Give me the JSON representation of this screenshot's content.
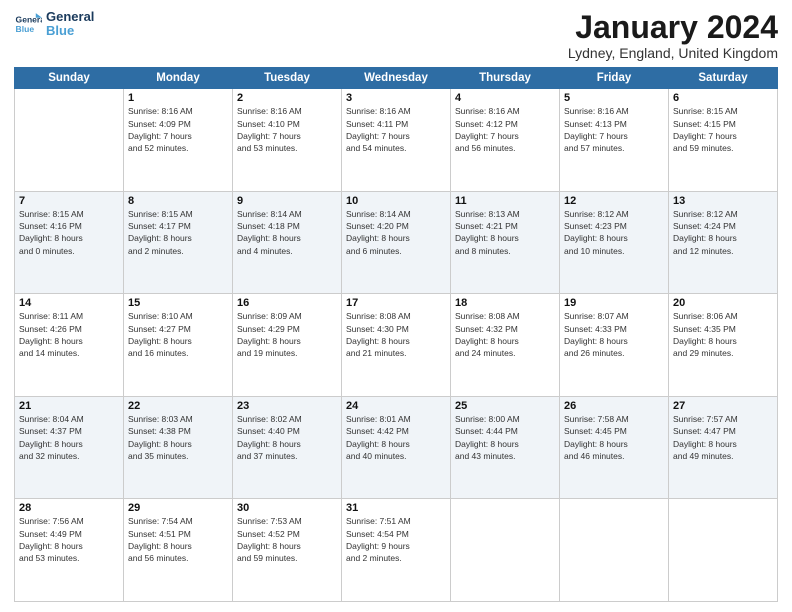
{
  "logo": {
    "line1": "General",
    "line2": "Blue"
  },
  "title": "January 2024",
  "location": "Lydney, England, United Kingdom",
  "days_header": [
    "Sunday",
    "Monday",
    "Tuesday",
    "Wednesday",
    "Thursday",
    "Friday",
    "Saturday"
  ],
  "weeks": [
    [
      {
        "num": "",
        "info": ""
      },
      {
        "num": "1",
        "info": "Sunrise: 8:16 AM\nSunset: 4:09 PM\nDaylight: 7 hours\nand 52 minutes."
      },
      {
        "num": "2",
        "info": "Sunrise: 8:16 AM\nSunset: 4:10 PM\nDaylight: 7 hours\nand 53 minutes."
      },
      {
        "num": "3",
        "info": "Sunrise: 8:16 AM\nSunset: 4:11 PM\nDaylight: 7 hours\nand 54 minutes."
      },
      {
        "num": "4",
        "info": "Sunrise: 8:16 AM\nSunset: 4:12 PM\nDaylight: 7 hours\nand 56 minutes."
      },
      {
        "num": "5",
        "info": "Sunrise: 8:16 AM\nSunset: 4:13 PM\nDaylight: 7 hours\nand 57 minutes."
      },
      {
        "num": "6",
        "info": "Sunrise: 8:15 AM\nSunset: 4:15 PM\nDaylight: 7 hours\nand 59 minutes."
      }
    ],
    [
      {
        "num": "7",
        "info": "Sunrise: 8:15 AM\nSunset: 4:16 PM\nDaylight: 8 hours\nand 0 minutes."
      },
      {
        "num": "8",
        "info": "Sunrise: 8:15 AM\nSunset: 4:17 PM\nDaylight: 8 hours\nand 2 minutes."
      },
      {
        "num": "9",
        "info": "Sunrise: 8:14 AM\nSunset: 4:18 PM\nDaylight: 8 hours\nand 4 minutes."
      },
      {
        "num": "10",
        "info": "Sunrise: 8:14 AM\nSunset: 4:20 PM\nDaylight: 8 hours\nand 6 minutes."
      },
      {
        "num": "11",
        "info": "Sunrise: 8:13 AM\nSunset: 4:21 PM\nDaylight: 8 hours\nand 8 minutes."
      },
      {
        "num": "12",
        "info": "Sunrise: 8:12 AM\nSunset: 4:23 PM\nDaylight: 8 hours\nand 10 minutes."
      },
      {
        "num": "13",
        "info": "Sunrise: 8:12 AM\nSunset: 4:24 PM\nDaylight: 8 hours\nand 12 minutes."
      }
    ],
    [
      {
        "num": "14",
        "info": "Sunrise: 8:11 AM\nSunset: 4:26 PM\nDaylight: 8 hours\nand 14 minutes."
      },
      {
        "num": "15",
        "info": "Sunrise: 8:10 AM\nSunset: 4:27 PM\nDaylight: 8 hours\nand 16 minutes."
      },
      {
        "num": "16",
        "info": "Sunrise: 8:09 AM\nSunset: 4:29 PM\nDaylight: 8 hours\nand 19 minutes."
      },
      {
        "num": "17",
        "info": "Sunrise: 8:08 AM\nSunset: 4:30 PM\nDaylight: 8 hours\nand 21 minutes."
      },
      {
        "num": "18",
        "info": "Sunrise: 8:08 AM\nSunset: 4:32 PM\nDaylight: 8 hours\nand 24 minutes."
      },
      {
        "num": "19",
        "info": "Sunrise: 8:07 AM\nSunset: 4:33 PM\nDaylight: 8 hours\nand 26 minutes."
      },
      {
        "num": "20",
        "info": "Sunrise: 8:06 AM\nSunset: 4:35 PM\nDaylight: 8 hours\nand 29 minutes."
      }
    ],
    [
      {
        "num": "21",
        "info": "Sunrise: 8:04 AM\nSunset: 4:37 PM\nDaylight: 8 hours\nand 32 minutes."
      },
      {
        "num": "22",
        "info": "Sunrise: 8:03 AM\nSunset: 4:38 PM\nDaylight: 8 hours\nand 35 minutes."
      },
      {
        "num": "23",
        "info": "Sunrise: 8:02 AM\nSunset: 4:40 PM\nDaylight: 8 hours\nand 37 minutes."
      },
      {
        "num": "24",
        "info": "Sunrise: 8:01 AM\nSunset: 4:42 PM\nDaylight: 8 hours\nand 40 minutes."
      },
      {
        "num": "25",
        "info": "Sunrise: 8:00 AM\nSunset: 4:44 PM\nDaylight: 8 hours\nand 43 minutes."
      },
      {
        "num": "26",
        "info": "Sunrise: 7:58 AM\nSunset: 4:45 PM\nDaylight: 8 hours\nand 46 minutes."
      },
      {
        "num": "27",
        "info": "Sunrise: 7:57 AM\nSunset: 4:47 PM\nDaylight: 8 hours\nand 49 minutes."
      }
    ],
    [
      {
        "num": "28",
        "info": "Sunrise: 7:56 AM\nSunset: 4:49 PM\nDaylight: 8 hours\nand 53 minutes."
      },
      {
        "num": "29",
        "info": "Sunrise: 7:54 AM\nSunset: 4:51 PM\nDaylight: 8 hours\nand 56 minutes."
      },
      {
        "num": "30",
        "info": "Sunrise: 7:53 AM\nSunset: 4:52 PM\nDaylight: 8 hours\nand 59 minutes."
      },
      {
        "num": "31",
        "info": "Sunrise: 7:51 AM\nSunset: 4:54 PM\nDaylight: 9 hours\nand 2 minutes."
      },
      {
        "num": "",
        "info": ""
      },
      {
        "num": "",
        "info": ""
      },
      {
        "num": "",
        "info": ""
      }
    ]
  ]
}
